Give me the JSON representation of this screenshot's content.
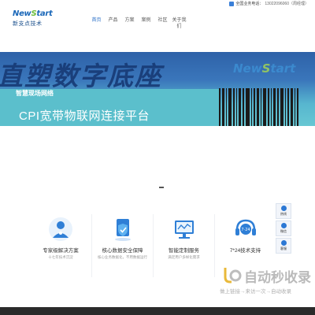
{
  "topbar": {
    "hotline_label": "全国业务电话：",
    "hotline_number": "13022096060（周经理）"
  },
  "header": {
    "logo_text": "NewStart",
    "logo_sub": "新支点技术",
    "nav": [
      {
        "label": "首页",
        "active": true
      },
      {
        "label": "产品",
        "active": false
      },
      {
        "label": "方案",
        "active": false
      },
      {
        "label": "案例",
        "active": false
      },
      {
        "label": "社区",
        "active": false
      },
      {
        "label": "关于我们",
        "active": false
      }
    ]
  },
  "hero": {
    "headline": "直塑数字底座",
    "brand": "NewStart",
    "tag": "智慧现场网络",
    "title": "CPI宽带物联网连接平台"
  },
  "features": [
    {
      "title": "专家级解决方案",
      "desc": "十七年技术沉淀",
      "icon": "expert-icon"
    },
    {
      "title": "核心数据安全保障",
      "desc": "核心业务数据化，不用数据运行",
      "icon": "shield-icon"
    },
    {
      "title": "智能定制服务",
      "desc": "满足用户多样化需求",
      "icon": "monitor-icon"
    },
    {
      "title": "7*24技术支持",
      "desc": "",
      "icon": "support-headset-icon"
    }
  ],
  "side_float": [
    {
      "label": "热线",
      "icon": "phone-icon"
    },
    {
      "label": "微信",
      "icon": "wechat-icon"
    },
    {
      "label": "客服",
      "icon": "user-icon"
    }
  ],
  "watermark": {
    "main": "自动秒收录",
    "sub": "做上链接→来访一次→自动收录"
  },
  "colors": {
    "accent": "#2a6fc7",
    "hero_top": "#2e62a8",
    "hero_bottom": "#67c7d3",
    "footer": "#2a2a2a"
  }
}
